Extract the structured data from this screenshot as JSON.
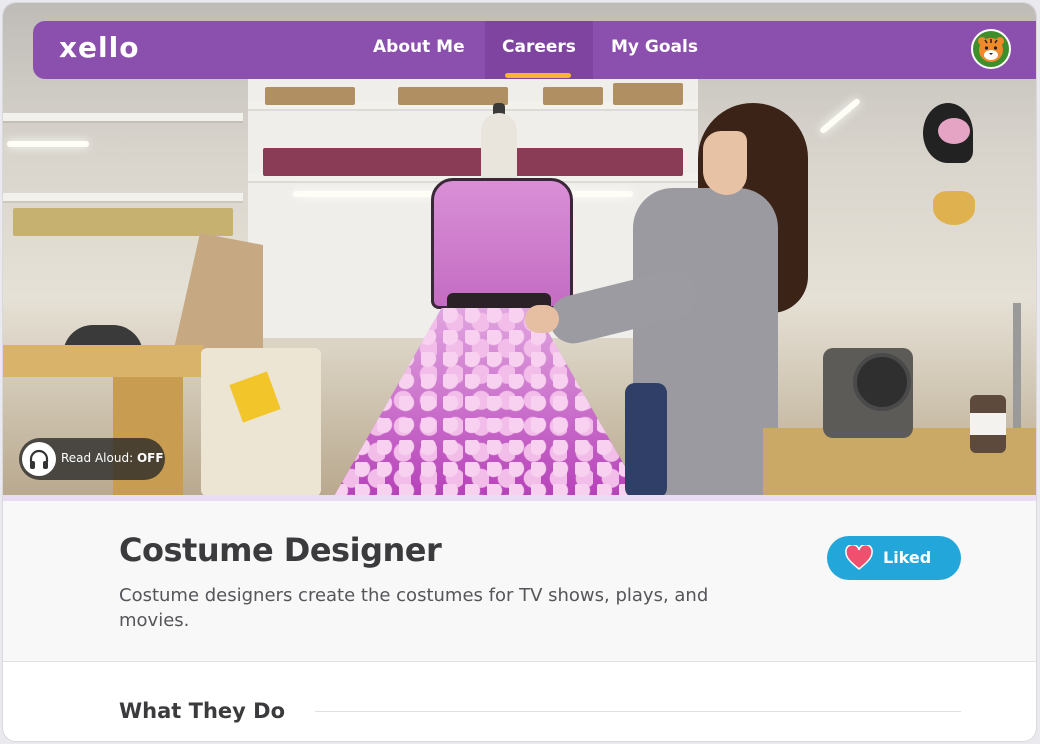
{
  "nav": {
    "logo": "xello",
    "items": [
      {
        "label": "About Me",
        "active": false
      },
      {
        "label": "Careers",
        "active": true
      },
      {
        "label": "My Goals",
        "active": false
      }
    ],
    "avatar_icon": "tiger-avatar-icon",
    "accent": "#8b4fad",
    "underline_color": "#f6b534"
  },
  "read_aloud": {
    "label": "Read Aloud:",
    "state": "OFF",
    "icon": "headphones-icon"
  },
  "career": {
    "title": "Costume Designer",
    "description": "Costume designers create the costumes for TV shows, plays, and movies.",
    "liked_label": "Liked",
    "liked_icon": "heart-icon",
    "liked_color": "#23a6d9",
    "heart_color": "#f0506e"
  },
  "sections": {
    "what_they_do": "What They Do"
  }
}
